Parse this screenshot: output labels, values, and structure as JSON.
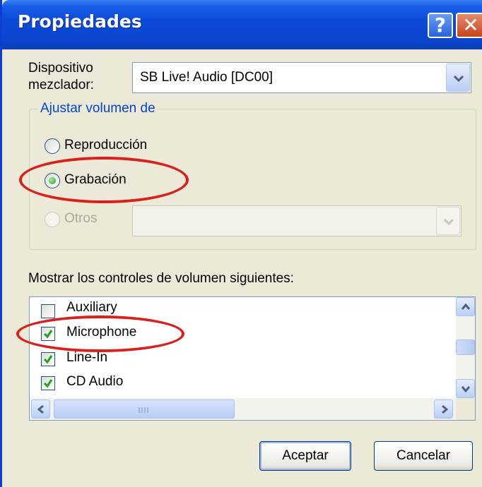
{
  "window": {
    "title": "Propiedades",
    "help_glyph": "?",
    "close_glyph": "✕"
  },
  "mixer": {
    "label_line1": "Dispositivo",
    "label_line2": "mezclador:",
    "selected": "SB Live! Audio [DC00]"
  },
  "adjust_group": {
    "legend": "Ajustar volumen de",
    "options": [
      {
        "label": "Reproducción",
        "selected": false,
        "enabled": true
      },
      {
        "label": "Grabación",
        "selected": true,
        "enabled": true
      },
      {
        "label": "Otros",
        "selected": false,
        "enabled": false
      }
    ],
    "others_combo_value": ""
  },
  "controls": {
    "heading": "Mostrar los controles de volumen siguientes:",
    "items": [
      {
        "label": "Auxiliary",
        "checked": false
      },
      {
        "label": "Microphone",
        "checked": true
      },
      {
        "label": "Line-In",
        "checked": true
      },
      {
        "label": "CD Audio",
        "checked": true
      }
    ]
  },
  "buttons": {
    "ok": "Aceptar",
    "cancel": "Cancelar"
  },
  "colors": {
    "title_bar": "#0a45cf",
    "annotation": "#d9201c",
    "group_legend": "#0046d5"
  }
}
